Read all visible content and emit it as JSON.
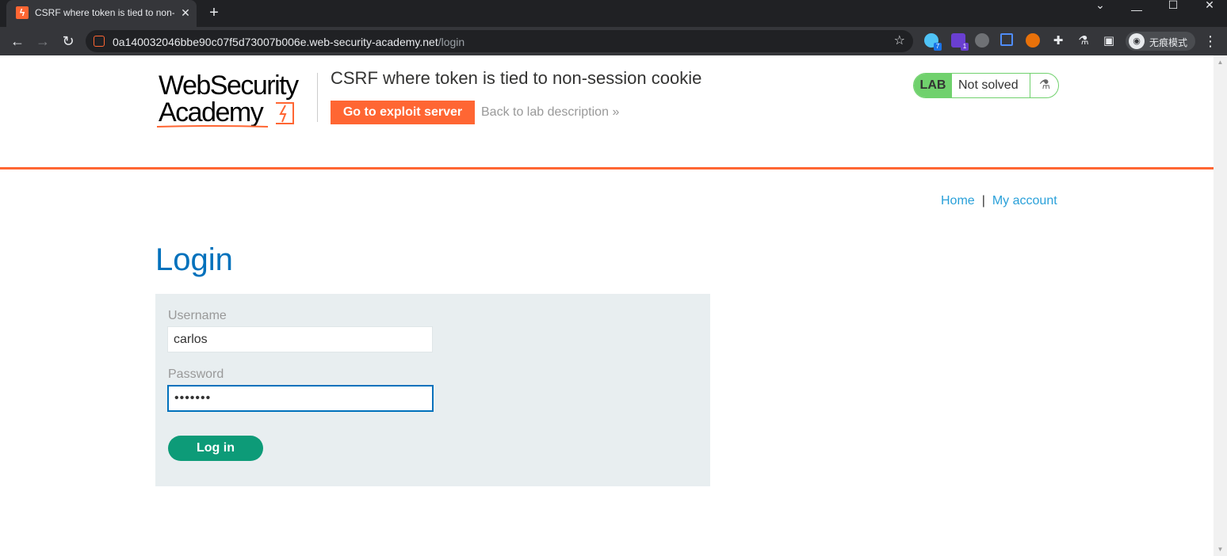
{
  "browser": {
    "tab_title": "CSRF where token is tied to non-session cookie",
    "url_host": "0a140032046bbe90c07f5d73007b006e.web-security-academy.net",
    "url_path": "/login",
    "incognito_label": "无痕模式",
    "extension_badges": [
      "7",
      "1"
    ]
  },
  "header": {
    "logo_line1": "WebSecurity",
    "logo_line2": "Academy",
    "lab_title": "CSRF where token is tied to non-session cookie",
    "exploit_button": "Go to exploit server",
    "back_link": "Back to lab description",
    "lab_tag": "LAB",
    "lab_status": "Not solved"
  },
  "nav": {
    "home": "Home",
    "separator": "|",
    "my_account": "My account"
  },
  "login": {
    "heading": "Login",
    "username_label": "Username",
    "username_value": "carlos",
    "password_label": "Password",
    "password_value": "•••••••",
    "submit_label": "Log in"
  },
  "colors": {
    "accent_orange": "#ff6633",
    "heading_blue": "#0071bc",
    "link_blue": "#29a0d9",
    "lab_green": "#70d16d",
    "button_teal": "#0d9b78",
    "panel_bg": "#e8eef0"
  }
}
